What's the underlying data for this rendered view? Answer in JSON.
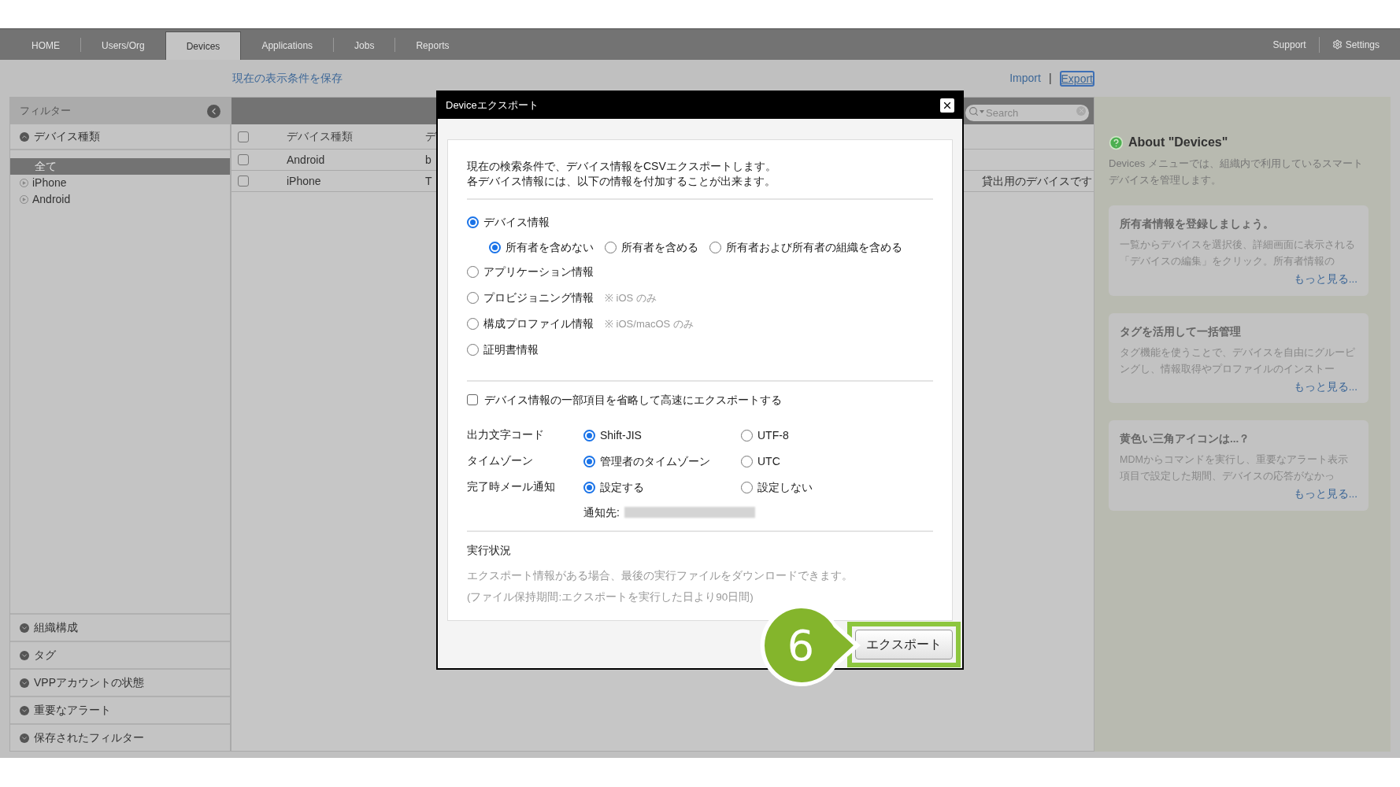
{
  "nav": {
    "tabs": [
      {
        "label": "HOME",
        "selected": false
      },
      {
        "label": "Users/Org",
        "selected": false
      },
      {
        "label": "Devices",
        "selected": true
      },
      {
        "label": "Applications",
        "selected": false
      },
      {
        "label": "Jobs",
        "selected": false
      },
      {
        "label": "Reports",
        "selected": false
      }
    ],
    "right": [
      {
        "label": "Support",
        "kind": "link"
      },
      {
        "label": "Settings",
        "kind": "settings"
      }
    ]
  },
  "toolbar": {
    "save_link": "現在の表示条件を保存",
    "import": "Import",
    "separator": "|",
    "export": "Export"
  },
  "sidebar": {
    "title": "フィルター",
    "sections": [
      {
        "label": "デバイス種類",
        "expanded": true,
        "items": [
          {
            "label": "全て",
            "selected": true
          },
          {
            "label": "iPhone",
            "selected": false
          },
          {
            "label": "Android",
            "selected": false
          }
        ]
      },
      {
        "label": "組織構成",
        "expanded": false
      },
      {
        "label": "タグ",
        "expanded": false
      },
      {
        "label": "VPPアカウントの状態",
        "expanded": false
      },
      {
        "label": "重要なアラート",
        "expanded": false
      },
      {
        "label": "保存されたフィルター",
        "expanded": false
      }
    ]
  },
  "table": {
    "search": {
      "placeholder": "Search"
    },
    "header_checked": false,
    "columns": [
      "デバイス種類",
      "デ"
    ],
    "rows": [
      {
        "checked": false,
        "type": "Android",
        "column_3": "b"
      },
      {
        "checked": false,
        "type": "iPhone",
        "column_3": "T",
        "column_4": "貸出用のデバイスです"
      }
    ]
  },
  "help": {
    "title": "About \"Devices\"",
    "text": "Devices メニューでは、組織内で利用しているスマートデバイスを管理します。",
    "cards": [
      {
        "title": "所有者情報を登録しましょう。",
        "text": "一覧からデバイスを選択後、詳細画面に表示される「デバイスの編集」をクリック。所有者情報の",
        "link": "もっと見る..."
      },
      {
        "title": "タグを活用して一括管理",
        "text": "タグ機能を使うことで、デバイスを自由にグルーピングし、情報取得やプロファイルのインストー",
        "link": "もっと見る..."
      },
      {
        "title": "黄色い三角アイコンは...？",
        "text": "MDMからコマンドを実行し、重要なアラート表示項目で設定した期間、デバイスの応答がなかっ",
        "link": "もっと見る..."
      }
    ]
  },
  "dialog": {
    "title": "Deviceエクスポート",
    "intro": [
      "現在の検索条件で、デバイス情報をCSVエクスポートします。",
      "各デバイス情報には、以下の情報を付加することが出来ます。"
    ],
    "types": [
      {
        "label": "デバイス情報",
        "selected": true,
        "sub": [
          {
            "label": "所有者を含めない",
            "selected": true
          },
          {
            "label": "所有者を含める",
            "selected": false
          },
          {
            "label": "所有者および所有者の組織を含める",
            "selected": false
          }
        ]
      },
      {
        "label": "アプリケーション情報",
        "selected": false
      },
      {
        "label": "プロビジョニング情報",
        "selected": false,
        "note": "※ iOS のみ"
      },
      {
        "label": "構成プロファイル情報",
        "selected": false,
        "note": "※ iOS/macOS のみ"
      },
      {
        "label": "証明書情報",
        "selected": false
      }
    ],
    "fast_export": {
      "label": "デバイス情報の一部項目を省略して高速にエクスポートする",
      "checked": false
    },
    "settings": [
      {
        "label": "出力文字コード",
        "options": [
          {
            "label": "Shift-JIS",
            "selected": true
          },
          {
            "label": "UTF-8",
            "selected": false
          }
        ]
      },
      {
        "label": "タイムゾーン",
        "options": [
          {
            "label": "管理者のタイムゾーン",
            "selected": true
          },
          {
            "label": "UTC",
            "selected": false
          }
        ]
      },
      {
        "label": "完了時メール通知",
        "options": [
          {
            "label": "設定する",
            "selected": true
          },
          {
            "label": "設定しない",
            "selected": false
          }
        ]
      }
    ],
    "notify_label": "通知先:",
    "status": {
      "title": "実行状況",
      "lines": [
        "エクスポート情報がある場合、最後の実行ファイルをダウンロードできます。",
        "(ファイル保持期間:エクスポートを実行した日より90日間)"
      ]
    },
    "button": "エクスポート"
  },
  "callout": "6"
}
